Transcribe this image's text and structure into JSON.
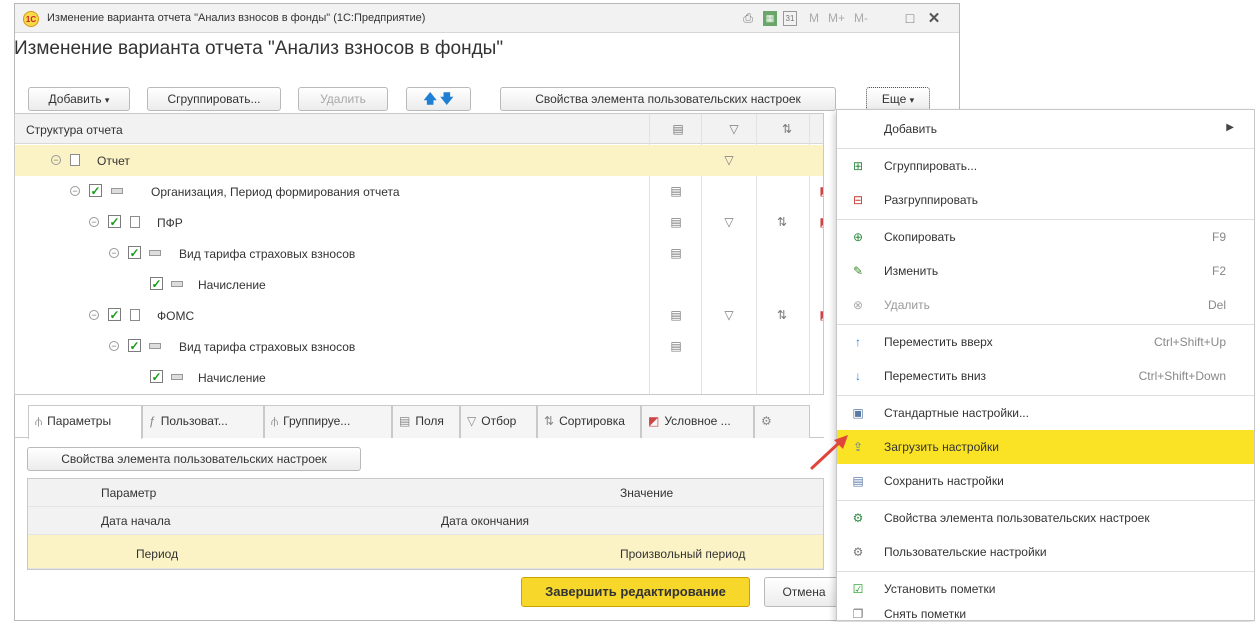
{
  "window": {
    "title": "Изменение варианта отчета \"Анализ взносов в фонды\"  (1С:Предприятие)",
    "logo_text": "1С",
    "title_icons": [
      "printer-icon",
      "calculator-icon",
      "calendar-icon"
    ],
    "memory_buttons": [
      "M",
      "M+",
      "M-"
    ]
  },
  "form": {
    "title": "Изменение варианта отчета \"Анализ взносов в фонды\""
  },
  "toolbar": {
    "add": "Добавить",
    "group": "Сгруппировать...",
    "delete": "Удалить",
    "up": "🡅",
    "down": "🡇",
    "properties": "Свойства элемента пользовательских настроек",
    "more": "Еще"
  },
  "tree": {
    "header": "Структура отчета",
    "rows": [
      {
        "label": "Отчет"
      },
      {
        "label": "Организация, Период формирования отчета"
      },
      {
        "label": "ПФР"
      },
      {
        "label": "Вид тарифа страховых взносов"
      },
      {
        "label": "Начисление"
      },
      {
        "label": "ФОМС"
      },
      {
        "label": "Вид тарифа страховых взносов"
      },
      {
        "label": "Начисление"
      }
    ]
  },
  "tabs": [
    {
      "label": "Параметры"
    },
    {
      "label": "Пользоват..."
    },
    {
      "label": "Группируе..."
    },
    {
      "label": "Поля"
    },
    {
      "label": "Отбор"
    },
    {
      "label": "Сортировка"
    },
    {
      "label": "Условное ..."
    }
  ],
  "params": {
    "button": "Свойства элемента пользовательских настроек",
    "col_param": "Параметр",
    "col_value": "Значение",
    "col_start": "Дата начала",
    "col_end": "Дата окончания",
    "row_name": "Период",
    "row_value": "Произвольный период"
  },
  "footer": {
    "finish": "Завершить редактирование",
    "cancel": "Отмена"
  },
  "menu": {
    "items": [
      {
        "label": "Добавить",
        "shortcut": ""
      },
      {
        "label": "Сгруппировать...",
        "shortcut": ""
      },
      {
        "label": "Разгруппировать",
        "shortcut": ""
      },
      {
        "label": "Скопировать",
        "shortcut": "F9"
      },
      {
        "label": "Изменить",
        "shortcut": "F2"
      },
      {
        "label": "Удалить",
        "shortcut": "Del"
      },
      {
        "label": "Переместить вверх",
        "shortcut": "Ctrl+Shift+Up"
      },
      {
        "label": "Переместить вниз",
        "shortcut": "Ctrl+Shift+Down"
      },
      {
        "label": "Стандартные настройки...",
        "shortcut": ""
      },
      {
        "label": "Загрузить настройки",
        "shortcut": ""
      },
      {
        "label": "Сохранить настройки",
        "shortcut": ""
      },
      {
        "label": "Свойства элемента пользовательских настроек",
        "shortcut": ""
      },
      {
        "label": "Пользовательские настройки",
        "shortcut": ""
      },
      {
        "label": "Установить пометки",
        "shortcut": ""
      },
      {
        "label": "Снять пометки",
        "shortcut": ""
      }
    ]
  },
  "colors": {
    "highlight": "#fae325",
    "selected_row": "#fbf3c6",
    "finish_button": "#f6d72a",
    "check": "#1a9a1a",
    "pointer": "#e0453a"
  }
}
